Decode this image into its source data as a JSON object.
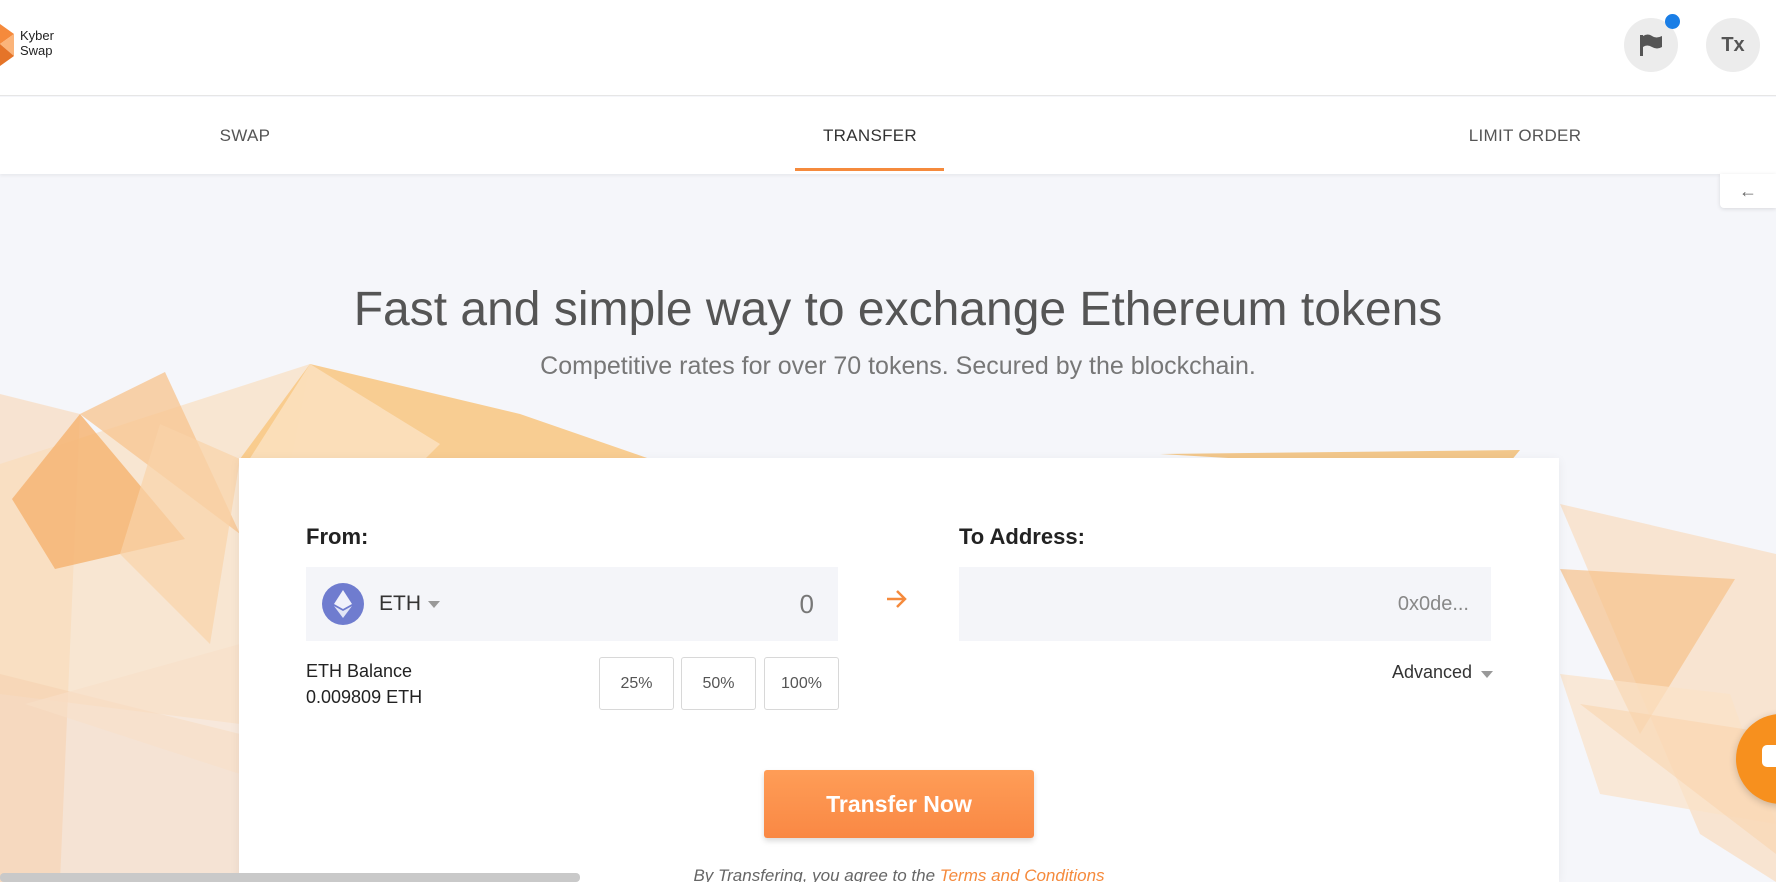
{
  "header": {
    "logo_line1": "Kyber",
    "logo_line2": "Swap",
    "tx_label": "Tx"
  },
  "tabs": [
    {
      "label": "SWAP",
      "active": false
    },
    {
      "label": "TRANSFER",
      "active": true
    },
    {
      "label": "LIMIT ORDER",
      "active": false
    }
  ],
  "hero": {
    "title": "Fast and simple way to exchange Ethereum tokens",
    "subtitle": "Competitive rates for over 70 tokens. Secured by the blockchain."
  },
  "transfer_form": {
    "from_label": "From:",
    "token": "ETH",
    "amount": "0",
    "to_label": "To Address:",
    "to_placeholder": "0x0de...",
    "balance_label": "ETH Balance",
    "balance_value": "0.009809 ETH",
    "percent_options": [
      "25%",
      "50%",
      "100%"
    ],
    "advanced_label": "Advanced",
    "submit_label": "Transfer Now",
    "terms_prefix": "By Transfering, you agree to the ",
    "terms_link": "Terms and Conditions"
  },
  "colors": {
    "accent": "#f58a3c",
    "eth": "#6f7ccf",
    "notification": "#1a7ee6"
  },
  "icons": [
    "kyber-logo-icon",
    "flag-icon",
    "arrow-right-icon",
    "eth-icon",
    "chevron-down-icon",
    "chat-icon",
    "collapse-arrow-icon"
  ]
}
